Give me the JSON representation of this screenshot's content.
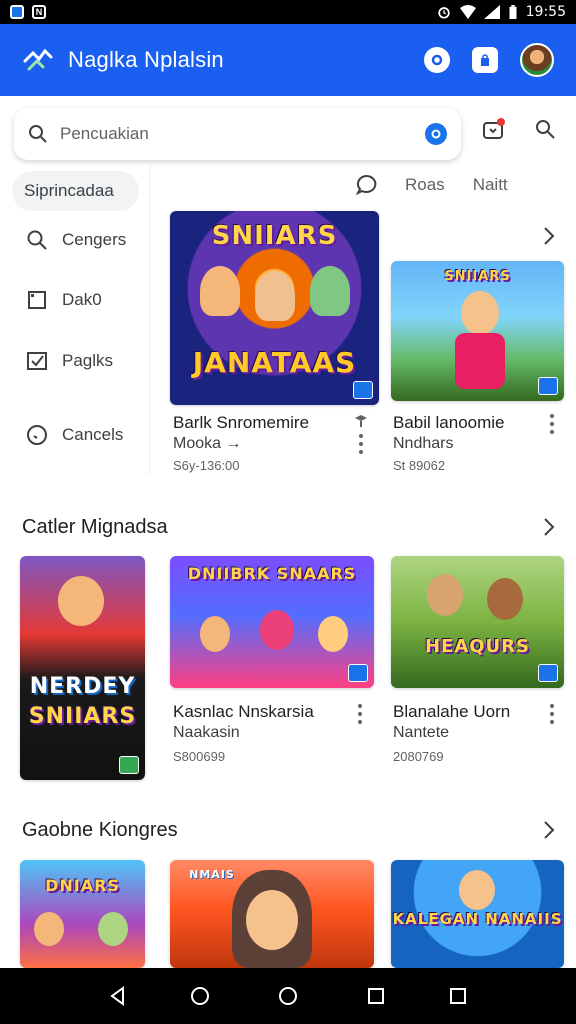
{
  "status_bar": {
    "time": "19:55"
  },
  "app_bar": {
    "title": "Naglka Nplalsin"
  },
  "search": {
    "placeholder": "Pencuakian"
  },
  "sidebar": {
    "header": "Siprincadaa",
    "items": [
      {
        "label": "Cengers",
        "icon": "search-icon"
      },
      {
        "label": "Dak0",
        "icon": "square-icon"
      },
      {
        "label": "Paglks",
        "icon": "checkbox-icon"
      },
      {
        "label": "Cancels",
        "icon": "clock-icon"
      }
    ]
  },
  "chips": [
    "Roas",
    "Naitt"
  ],
  "featured": {
    "cards": [
      {
        "title": "Barlk Snromemire",
        "subtitle": "Mooka →",
        "meta": "S6y-136:00",
        "art_title": "SNIIARS",
        "art_sub": "JANATAAS"
      },
      {
        "title": "Babil lanoomie",
        "subtitle": "Nndhars",
        "meta": "St 89062",
        "art_title": "SNIIARS"
      }
    ]
  },
  "sections": [
    {
      "title": "Catler Mignadsa",
      "cards": [
        {
          "art_title": "NERDEY",
          "art_sub": "SNIIARS"
        },
        {
          "title": "Kasnlac Nnskarsia",
          "subtitle": "Naakasin",
          "meta": "S800699",
          "art_title": "DNIIBRK SNAARS"
        },
        {
          "title": "Blanalahe Uorn",
          "subtitle": "Nantete",
          "meta": "2080769",
          "art_title": "HEAQURS"
        }
      ]
    },
    {
      "title": "Gaobne Kiongres",
      "cards": [
        {
          "art_title": "DNIARS"
        },
        {
          "art_title": "NMAIS"
        },
        {
          "art_title": "KALEGAN NANAIIS"
        }
      ]
    }
  ],
  "colors": {
    "accent": "#1a5ff0",
    "brand_blue": "#1a73e8",
    "text": "#202124"
  }
}
